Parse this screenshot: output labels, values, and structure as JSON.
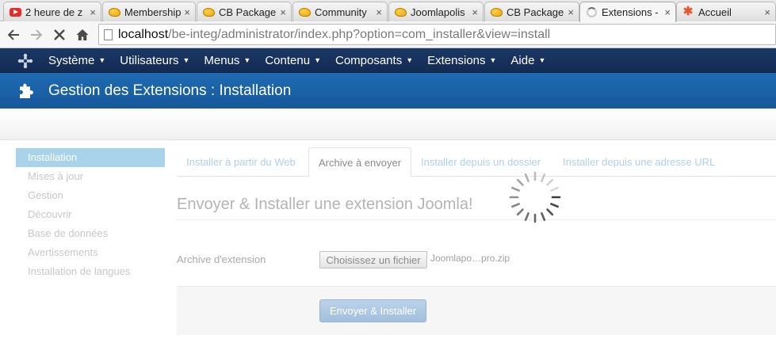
{
  "browser": {
    "tabs": [
      {
        "title": "2 heure de z",
        "icon": "youtube-icon"
      },
      {
        "title": "Membership",
        "icon": "joomlapolis-icon"
      },
      {
        "title": "CB Packager",
        "icon": "joomlapolis-icon"
      },
      {
        "title": "Community",
        "icon": "joomlapolis-icon"
      },
      {
        "title": "Joomlapolis",
        "icon": "joomlapolis-icon"
      },
      {
        "title": "CB Packager",
        "icon": "joomlapolis-icon"
      },
      {
        "title": "Extensions -",
        "icon": "loading-icon"
      },
      {
        "title": "Accueil",
        "icon": "joomla-icon"
      }
    ],
    "close_glyph": "×",
    "url_host": "localhost",
    "url_path": "/be-integ/administrator/index.php?option=com_installer&view=install"
  },
  "topnav": {
    "items": [
      "Système",
      "Utilisateurs",
      "Menus",
      "Contenu",
      "Composants",
      "Extensions",
      "Aide"
    ],
    "caret": "▼"
  },
  "header": {
    "title": "Gestion des Extensions : Installation"
  },
  "sidebar": {
    "items": [
      "Installation",
      "Mises à jour",
      "Gestion",
      "Découvrir",
      "Base de données",
      "Avertissements",
      "Installation de langues"
    ]
  },
  "main": {
    "tabs": [
      "Installer à partir du Web",
      "Archive à envoyer",
      "Installer depuis un dossier",
      "Installer depuis une adresse URL"
    ],
    "legend": "Envoyer & Installer une extension Joomla!",
    "field_label": "Archive d'extension",
    "file_button": "Choisissez un fichier",
    "file_name": "Joomlapo…pro.zip",
    "submit_button": "Envoyer & Installer"
  },
  "colors": {
    "nav_bg": "#132b52",
    "title_bg": "#1c66ad",
    "sidebar_active": "#a8d3ea",
    "submit_bg": "#a9c4e0"
  }
}
